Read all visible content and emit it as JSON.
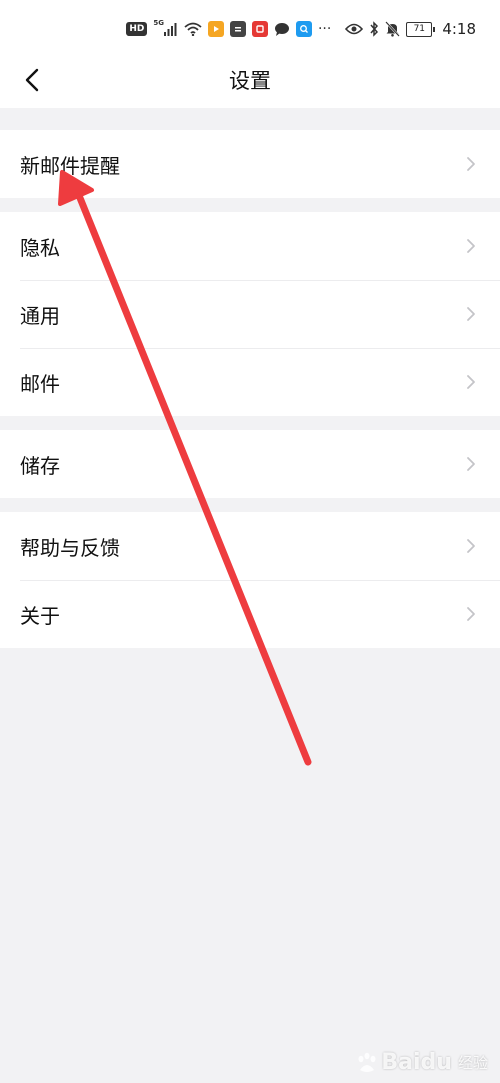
{
  "status_bar": {
    "hd": "HD",
    "signal": "5G",
    "battery": "71",
    "time": "4:18"
  },
  "header": {
    "title": "设置"
  },
  "settings_groups": [
    {
      "items": [
        {
          "label": "新邮件提醒"
        }
      ]
    },
    {
      "items": [
        {
          "label": "隐私"
        },
        {
          "label": "通用"
        },
        {
          "label": "邮件"
        }
      ]
    },
    {
      "items": [
        {
          "label": "储存"
        }
      ]
    },
    {
      "items": [
        {
          "label": "帮助与反馈"
        },
        {
          "label": "关于"
        }
      ]
    }
  ],
  "watermark": {
    "brand": "Baidu",
    "sub": "经验"
  },
  "colors": {
    "annotation_arrow": "#ee3c3f",
    "background": "#f2f2f4",
    "surface": "#ffffff",
    "chevron": "#c4c4c8"
  },
  "icons": {
    "back": "chevron-left-icon",
    "row_chevron": "chevron-right-icon"
  }
}
